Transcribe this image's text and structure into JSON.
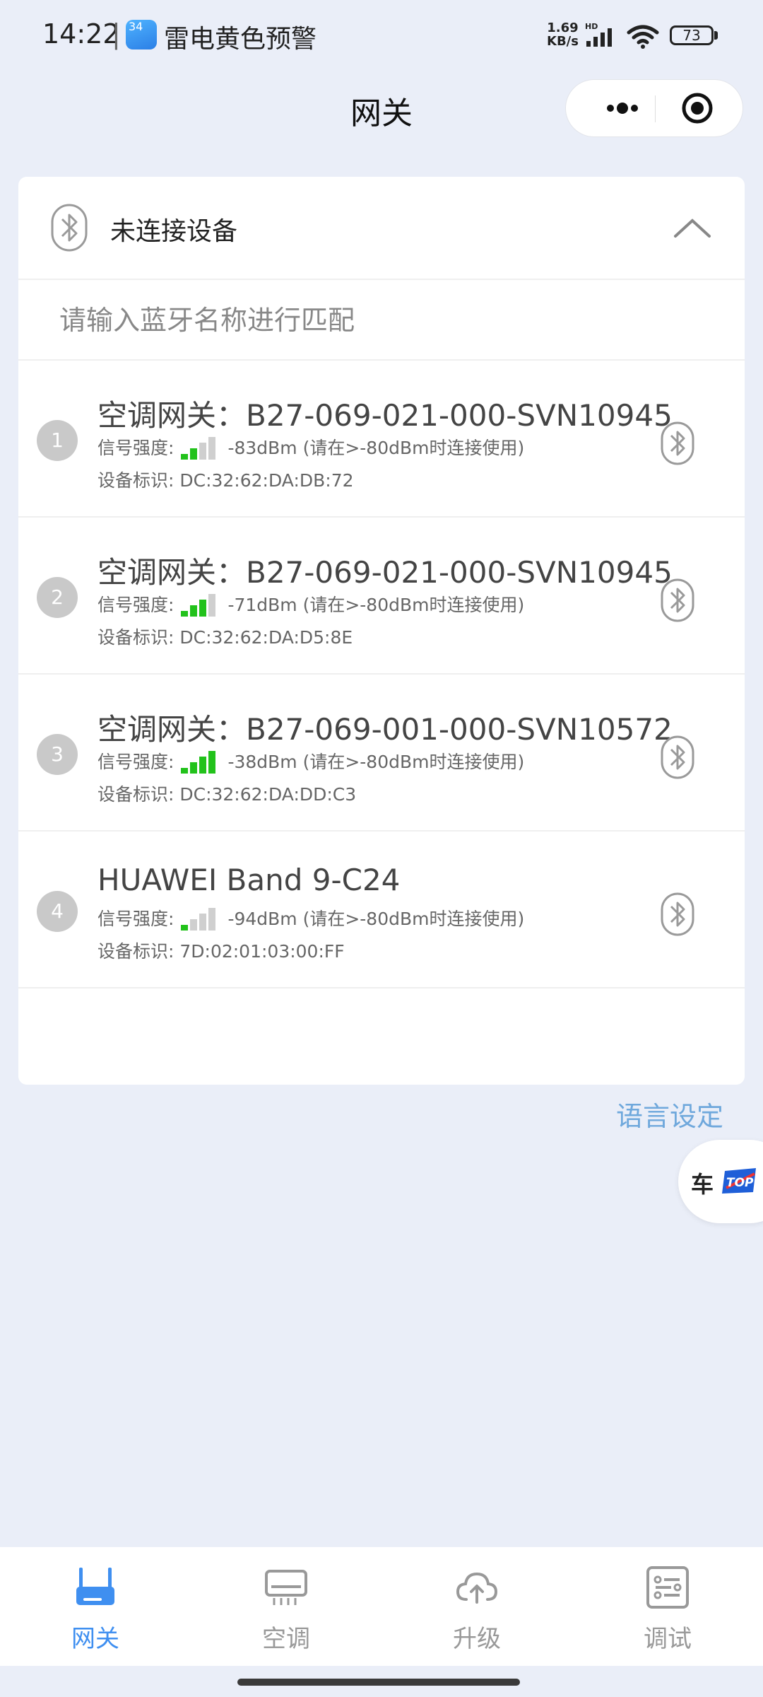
{
  "status_bar": {
    "time": "14:22",
    "separator": "|",
    "weather_badge": "34",
    "weather_alert": "雷电黄色预警",
    "net_speed_value": "1.69",
    "net_speed_unit": "KB/s",
    "hd_label": "HD",
    "battery": "73"
  },
  "nav": {
    "title": "网关",
    "more_icon": "more-dots-icon",
    "close_icon": "target-close-icon"
  },
  "card": {
    "header_title": "未连接设备",
    "header_icon": "bluetooth-icon",
    "collapse_icon": "chevron-up-icon",
    "search_placeholder": "请输入蓝牙名称进行匹配",
    "devices": [
      {
        "index": "1",
        "name": "空调网关：B27-069-021-000-SVN10945",
        "signal_label": "信号强度:",
        "signal_level": 2,
        "signal_value": "-83dBm (请在>-80dBm时连接使用)",
        "id_line": "设备标识: DC:32:62:DA:DB:72"
      },
      {
        "index": "2",
        "name": "空调网关：B27-069-021-000-SVN10945",
        "signal_label": "信号强度:",
        "signal_level": 3,
        "signal_value": "-71dBm (请在>-80dBm时连接使用)",
        "id_line": "设备标识: DC:32:62:DA:D5:8E"
      },
      {
        "index": "3",
        "name": "空调网关：B27-069-001-000-SVN10572",
        "signal_label": "信号强度:",
        "signal_level": 4,
        "signal_value": "-38dBm (请在>-80dBm时连接使用)",
        "id_line": "设备标识: DC:32:62:DA:DD:C3"
      },
      {
        "index": "4",
        "name": "HUAWEI Band 9-C24",
        "signal_label": "信号强度:",
        "signal_level": 1,
        "signal_value": "-94dBm (请在>-80dBm时连接使用)",
        "id_line": "设备标识: 7D:02:01:03:00:FF"
      }
    ]
  },
  "language_link": "语言设定",
  "floating_logo": {
    "char": "车",
    "badge": "TOP"
  },
  "tab_bar": {
    "tabs": [
      {
        "label": "网关",
        "icon": "router-icon",
        "active": true
      },
      {
        "label": "空调",
        "icon": "air-conditioner-icon",
        "active": false
      },
      {
        "label": "升级",
        "icon": "cloud-upload-icon",
        "active": false
      },
      {
        "label": "调试",
        "icon": "settings-list-icon",
        "active": false
      }
    ]
  },
  "colors": {
    "accent": "#3f8ff0",
    "signal_on": "#22c21b",
    "signal_off": "#cfcfcf",
    "link": "#6fa8dc",
    "background": "#eaeef8"
  }
}
